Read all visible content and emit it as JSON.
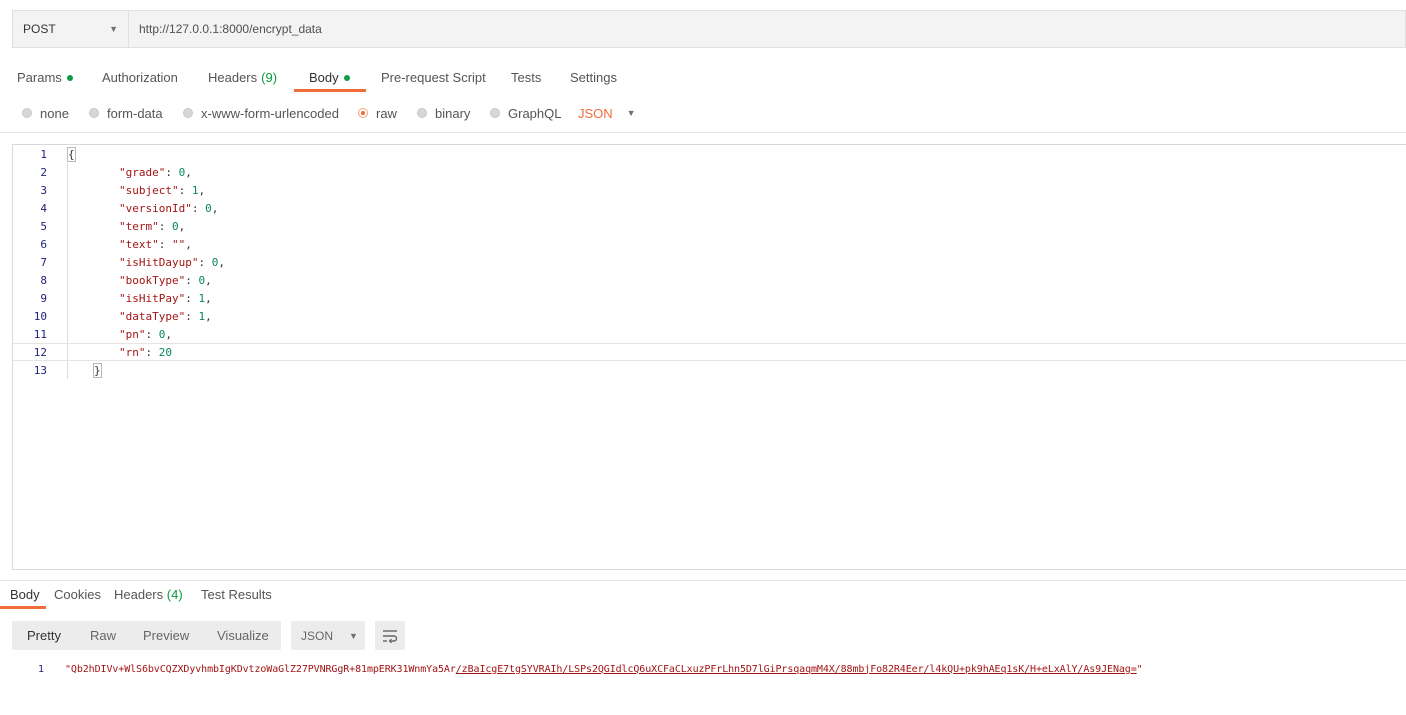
{
  "request": {
    "method": "POST",
    "url": "http://127.0.0.1:8000/encrypt_data"
  },
  "request_tabs": [
    {
      "label": "Params",
      "indicator": true
    },
    {
      "label": "Authorization"
    },
    {
      "label": "Headers",
      "count": "(9)"
    },
    {
      "label": "Body",
      "indicator": true,
      "active": true
    },
    {
      "label": "Pre-request Script"
    },
    {
      "label": "Tests"
    },
    {
      "label": "Settings"
    }
  ],
  "body_types": [
    {
      "label": "none"
    },
    {
      "label": "form-data"
    },
    {
      "label": "x-www-form-urlencoded"
    },
    {
      "label": "raw",
      "selected": true
    },
    {
      "label": "binary"
    },
    {
      "label": "GraphQL"
    }
  ],
  "body_format": "JSON",
  "editor": {
    "current_line": 12,
    "lines": [
      {
        "num": "1",
        "text": "{"
      },
      {
        "num": "2",
        "key": "\"grade\"",
        "value": "0",
        "tail": ","
      },
      {
        "num": "3",
        "key": "\"subject\"",
        "value": "1",
        "tail": ","
      },
      {
        "num": "4",
        "key": "\"versionId\"",
        "value": "0",
        "tail": ","
      },
      {
        "num": "5",
        "key": "\"term\"",
        "value": "0",
        "tail": ","
      },
      {
        "num": "6",
        "key": "\"text\"",
        "value": "\"\"",
        "tail": ","
      },
      {
        "num": "7",
        "key": "\"isHitDayup\"",
        "value": "0",
        "tail": ","
      },
      {
        "num": "8",
        "key": "\"bookType\"",
        "value": "0",
        "tail": ","
      },
      {
        "num": "9",
        "key": "\"isHitPay\"",
        "value": "1",
        "tail": ","
      },
      {
        "num": "10",
        "key": "\"dataType\"",
        "value": "1",
        "tail": ","
      },
      {
        "num": "11",
        "key": "\"pn\"",
        "value": "0",
        "tail": ","
      },
      {
        "num": "12",
        "key": "\"rn\"",
        "value": "20",
        "tail": ""
      },
      {
        "num": "13",
        "text": "}"
      }
    ]
  },
  "response_tabs": [
    {
      "label": "Body",
      "active": true
    },
    {
      "label": "Cookies"
    },
    {
      "label": "Headers",
      "count": "(4)"
    },
    {
      "label": "Test Results"
    }
  ],
  "response_views": [
    "Pretty",
    "Raw",
    "Preview",
    "Visualize"
  ],
  "response_active_view": "Pretty",
  "response_format": "JSON",
  "response": {
    "line_num": "1",
    "text_a": "\"Qb2hDIVv+WlS6bvCQZXDyvhmbIgKDvtzoWaGlZ27PVNRGgR+81mpERK31WnmYa5Ar",
    "text_b": "/zBaIcgE7tgSYVRAIh/LSPs2QGIdlcQ6uXCFaCLxuzPFrLhn5D7lGiPrsqaqmM4X/88mbjFo82R4Eer/l4kQU+pk9hAEq1sK/H+eLxAlY/As9JENag=",
    "text_c": "\""
  },
  "icons": {
    "method_caret": "caret-down-icon",
    "wrap": "wrap-lines-icon"
  }
}
